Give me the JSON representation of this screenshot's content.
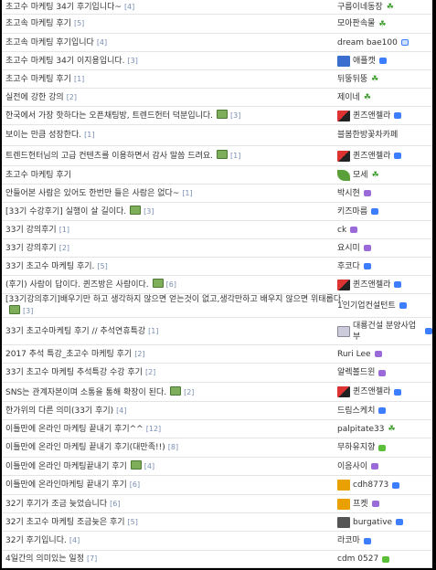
{
  "posts": [
    {
      "title": "초고수 마케팅 34기 후기입니다~",
      "comments": "[4]",
      "author": "구름이네동장",
      "author_icon": "none",
      "level_icon": "sprout-icon"
    },
    {
      "title": "초고속 마케팅 후기",
      "comments": "[5]",
      "author": "모아판속물",
      "author_icon": "none",
      "level_icon": "sprout-icon"
    },
    {
      "title": "초고속 마케팅 후기입니다",
      "comments": "[4]",
      "author": "dream bae100",
      "author_icon": "none",
      "level_icon": "level-box-icon"
    },
    {
      "title": "초고수 마케팅 34기 이지용입니다.",
      "comments": "[3]",
      "author": "애플캣",
      "author_icon": "badge-icon",
      "level_icon": "level-blue-icon"
    },
    {
      "title": "초고수 마케팅 후기",
      "comments": "[1]",
      "author": "뒤뚱뒤뚱",
      "author_icon": "none",
      "level_icon": "sprout-icon"
    },
    {
      "title": "실전에 강한 강의",
      "comments": "[2]",
      "author": "제이네",
      "author_icon": "none",
      "level_icon": "sprout-icon"
    },
    {
      "title": "한국에서 가장 핫하다는 오픈채팅방, 트렌드헌터 덕분입니다.",
      "comments": "[3]",
      "has_photo": true,
      "author": "퀸즈앤젤라",
      "author_icon": "queen-icon",
      "level_icon": "level-blue-icon"
    },
    {
      "title": "보이는 만큼 성장한다.",
      "comments": "[1]",
      "author": "블봄한방꽃차카페",
      "author_icon": "none",
      "level_icon": "none",
      "author_multiline": true
    },
    {
      "title": "트렌드헌터님의 고급 컨텐츠를 이용하면서 감사 말씀 드려요.",
      "comments": "[1]",
      "has_photo": true,
      "author": "퀸즈앤젤라",
      "author_icon": "queen-icon",
      "level_icon": "level-blue-icon"
    },
    {
      "title": "초고수 마케팅 후기",
      "comments": "",
      "author": "모세",
      "author_icon": "leaf-icon",
      "level_icon": "sprout-icon"
    },
    {
      "title": "안들어본 사람은 있어도 한번만 들은 사람은 없다~",
      "comments": "[1]",
      "author": "박시현",
      "author_icon": "none",
      "level_icon": "level-purple-icon"
    },
    {
      "title": "[33기 수강후기] 실행이 살 길이다.",
      "comments": "[3]",
      "has_photo": true,
      "author": "키즈마름",
      "author_icon": "none",
      "level_icon": "level-blue-icon"
    },
    {
      "title": "33기 강의후기",
      "comments": "[1]",
      "author": "ck",
      "author_icon": "none",
      "level_icon": "level-purple-icon"
    },
    {
      "title": "33기 강의후기",
      "comments": "[2]",
      "author": "요시미",
      "author_icon": "none",
      "level_icon": "level-purple-icon"
    },
    {
      "title": "33기 초고수 마케팅 후기.",
      "comments": "[5]",
      "author": "후코다",
      "author_icon": "none",
      "level_icon": "level-blue-icon"
    },
    {
      "title": "(후기) 사람이 답이다. 퀸즈방은 사람이다.",
      "comments": "[6]",
      "has_photo": true,
      "author": "퀸즈앤젤라",
      "author_icon": "queen-icon",
      "level_icon": "level-blue-icon"
    },
    {
      "title": "[33기강의후기]배우기만 하고 생각하지 않으면 얻는것이 없고,생각만하고 배우지 않으면 위태롭다.",
      "comments": "[3]",
      "has_photo": true,
      "title_multiline": true,
      "author": "1인기업컨설턴트",
      "author_icon": "none",
      "level_icon": "level-blue-icon"
    },
    {
      "title": "33기 초고수마케팅 후기 // 추석연휴특강",
      "comments": "[1]",
      "author": "대룡건설 분양사업부",
      "author_icon": "mail-icon",
      "level_icon": "level-blue-icon",
      "author_multiline": true
    },
    {
      "title": "2017 추석 특강_초고수 마케팅 후기",
      "comments": "[2]",
      "author": "Ruri Lee",
      "author_icon": "none",
      "level_icon": "level-purple-icon"
    },
    {
      "title": "33기 초고수 마케팅 추석특강 수강 후기",
      "comments": "[2]",
      "author": "알렉볼드윈",
      "author_icon": "none",
      "level_icon": "level-purple-icon"
    },
    {
      "title": "SNS는 관계자본이며 소통을 통해 확장이 된다.",
      "comments": "[2]",
      "has_photo": true,
      "author": "퀸즈앤젤라",
      "author_icon": "queen-icon",
      "level_icon": "level-blue-icon"
    },
    {
      "title": "한가위의 다른 의미(33기 후기)",
      "comments": "[4]",
      "author": "드림스케치",
      "author_icon": "none",
      "level_icon": "level-blue-icon"
    },
    {
      "title": "이틀만에 온라인 마케팅 끝내기 후기^^",
      "comments": "[12]",
      "author": "palpitate33",
      "author_icon": "none",
      "level_icon": "sprout-icon"
    },
    {
      "title": "이틀만에 온라인 마케팅 끝내기 후기(대만족!!)",
      "comments": "[8]",
      "author": "무하유지향",
      "author_icon": "none",
      "level_icon": "level-green-icon"
    },
    {
      "title": "이틀만에 온라인 마케팅끝내기 후기",
      "comments": "[4]",
      "has_photo": true,
      "author": "이음사이",
      "author_icon": "none",
      "level_icon": "level-purple-icon"
    },
    {
      "title": "이틀만에 온라인마케팅 끝내기 후기",
      "comments": "[6]",
      "author": "cdh8773",
      "author_icon": "gold-icon",
      "level_icon": "level-blue-icon"
    },
    {
      "title": "32기 후기가 조금 늦었습니다",
      "comments": "[6]",
      "author": "프켓",
      "author_icon": "gold-icon",
      "level_icon": "level-purple-icon"
    },
    {
      "title": "32기 초고수 마케팅 조금늦은 후기",
      "comments": "[5]",
      "author": "burgative",
      "author_icon": "car-icon",
      "level_icon": "level-blue-icon"
    },
    {
      "title": "32기 후기입니다.",
      "comments": "[4]",
      "author": "라코마",
      "author_icon": "none",
      "level_icon": "level-blue-icon"
    },
    {
      "title": "4일간의 의미있는 일정",
      "comments": "[7]",
      "author": "cdm 0527",
      "author_icon": "none",
      "level_icon": "level-green-icon"
    }
  ]
}
